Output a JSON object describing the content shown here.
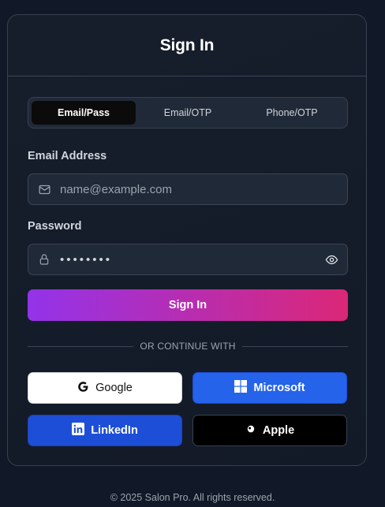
{
  "card": {
    "title": "Sign In"
  },
  "tabs": [
    {
      "label": "Email/Pass",
      "active": true
    },
    {
      "label": "Email/OTP",
      "active": false
    },
    {
      "label": "Phone/OTP",
      "active": false
    }
  ],
  "email": {
    "label": "Email Address",
    "placeholder": "name@example.com",
    "value": "",
    "icon": "mail-icon"
  },
  "password": {
    "label": "Password",
    "value": "••••••••",
    "icon": "lock-icon",
    "toggle_icon": "eye-icon"
  },
  "submit": {
    "label": "Sign In"
  },
  "divider": {
    "text": "OR CONTINUE WITH"
  },
  "social": {
    "google": {
      "label": "Google",
      "icon": "google-icon"
    },
    "microsoft": {
      "label": "Microsoft",
      "icon": "microsoft-icon"
    },
    "linkedin": {
      "label": "LinkedIn",
      "icon": "linkedin-icon"
    },
    "apple": {
      "label": "Apple",
      "icon": "apple-icon"
    }
  },
  "footer": {
    "text": "© 2025 Salon Pro. All rights reserved."
  },
  "colors": {
    "background": "#111827",
    "accent_gradient_start": "#9333ea",
    "accent_gradient_end": "#db2777",
    "microsoft": "#2563eb",
    "linkedin": "#1d4ed8"
  }
}
